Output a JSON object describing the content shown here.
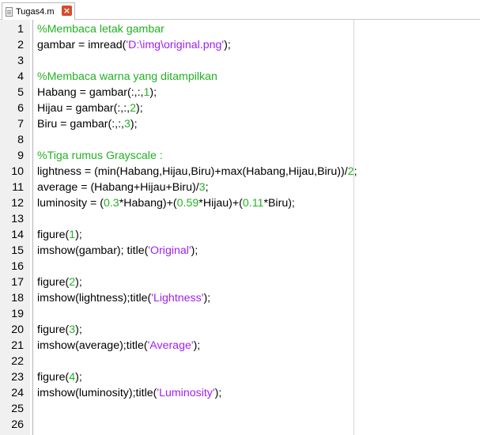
{
  "tab": {
    "filename": "Tugas4.m",
    "close_glyph": "×"
  },
  "icons": {
    "file": "m-file-icon",
    "close": "close-icon"
  },
  "colors": {
    "comment": "#22b222",
    "number": "#22b222",
    "string": "#a020f0",
    "tab_close": "#d94a2b"
  },
  "lines": [
    {
      "n": "1",
      "tokens": [
        {
          "t": "c",
          "v": "%Membaca letak gambar"
        }
      ]
    },
    {
      "n": "2",
      "tokens": [
        {
          "t": "p",
          "v": "gambar = imread("
        },
        {
          "t": "s",
          "v": "'D:\\img\\original.png'"
        },
        {
          "t": "p",
          "v": ");"
        }
      ]
    },
    {
      "n": "3",
      "tokens": []
    },
    {
      "n": "4",
      "tokens": [
        {
          "t": "c",
          "v": "%Membaca warna yang ditampilkan"
        }
      ]
    },
    {
      "n": "5",
      "tokens": [
        {
          "t": "p",
          "v": "Habang = gambar(:,:,"
        },
        {
          "t": "n",
          "v": "1"
        },
        {
          "t": "p",
          "v": ");"
        }
      ]
    },
    {
      "n": "6",
      "tokens": [
        {
          "t": "p",
          "v": "Hijau = gambar(:,:,"
        },
        {
          "t": "n",
          "v": "2"
        },
        {
          "t": "p",
          "v": ");"
        }
      ]
    },
    {
      "n": "7",
      "tokens": [
        {
          "t": "p",
          "v": "Biru = gambar(:,:,"
        },
        {
          "t": "n",
          "v": "3"
        },
        {
          "t": "p",
          "v": ");"
        }
      ]
    },
    {
      "n": "8",
      "tokens": []
    },
    {
      "n": "9",
      "tokens": [
        {
          "t": "c",
          "v": "%Tiga rumus Grayscale :"
        }
      ]
    },
    {
      "n": "10",
      "tokens": [
        {
          "t": "p",
          "v": "lightness = (min(Habang,Hijau,Biru)+max(Habang,Hijau,Biru))/"
        },
        {
          "t": "n",
          "v": "2"
        },
        {
          "t": "p",
          "v": ";"
        }
      ]
    },
    {
      "n": "11",
      "tokens": [
        {
          "t": "p",
          "v": "average = (Habang+Hijau+Biru)/"
        },
        {
          "t": "n",
          "v": "3"
        },
        {
          "t": "p",
          "v": ";"
        }
      ]
    },
    {
      "n": "12",
      "tokens": [
        {
          "t": "p",
          "v": "luminosity = ("
        },
        {
          "t": "n",
          "v": "0.3"
        },
        {
          "t": "p",
          "v": "*Habang)+("
        },
        {
          "t": "n",
          "v": "0.59"
        },
        {
          "t": "p",
          "v": "*Hijau)+("
        },
        {
          "t": "n",
          "v": "0.11"
        },
        {
          "t": "p",
          "v": "*Biru);"
        }
      ]
    },
    {
      "n": "13",
      "tokens": []
    },
    {
      "n": "14",
      "tokens": [
        {
          "t": "p",
          "v": "figure("
        },
        {
          "t": "n",
          "v": "1"
        },
        {
          "t": "p",
          "v": ");"
        }
      ]
    },
    {
      "n": "15",
      "tokens": [
        {
          "t": "p",
          "v": "imshow(gambar); title("
        },
        {
          "t": "s",
          "v": "'Original'"
        },
        {
          "t": "p",
          "v": ");"
        }
      ]
    },
    {
      "n": "16",
      "tokens": []
    },
    {
      "n": "17",
      "tokens": [
        {
          "t": "p",
          "v": "figure("
        },
        {
          "t": "n",
          "v": "2"
        },
        {
          "t": "p",
          "v": ");"
        }
      ]
    },
    {
      "n": "18",
      "tokens": [
        {
          "t": "p",
          "v": "imshow(lightness);title("
        },
        {
          "t": "s",
          "v": "'Lightness'"
        },
        {
          "t": "p",
          "v": ");"
        }
      ]
    },
    {
      "n": "19",
      "tokens": []
    },
    {
      "n": "20",
      "tokens": [
        {
          "t": "p",
          "v": "figure("
        },
        {
          "t": "n",
          "v": "3"
        },
        {
          "t": "p",
          "v": ");"
        }
      ]
    },
    {
      "n": "21",
      "tokens": [
        {
          "t": "p",
          "v": "imshow(average);title("
        },
        {
          "t": "s",
          "v": "'Average'"
        },
        {
          "t": "p",
          "v": ");"
        }
      ]
    },
    {
      "n": "22",
      "tokens": []
    },
    {
      "n": "23",
      "tokens": [
        {
          "t": "p",
          "v": "figure("
        },
        {
          "t": "n",
          "v": "4"
        },
        {
          "t": "p",
          "v": ");"
        }
      ]
    },
    {
      "n": "24",
      "tokens": [
        {
          "t": "p",
          "v": "imshow(luminosity);title("
        },
        {
          "t": "s",
          "v": "'Luminosity'"
        },
        {
          "t": "p",
          "v": ");"
        }
      ]
    },
    {
      "n": "25",
      "tokens": []
    },
    {
      "n": "26",
      "tokens": []
    }
  ]
}
